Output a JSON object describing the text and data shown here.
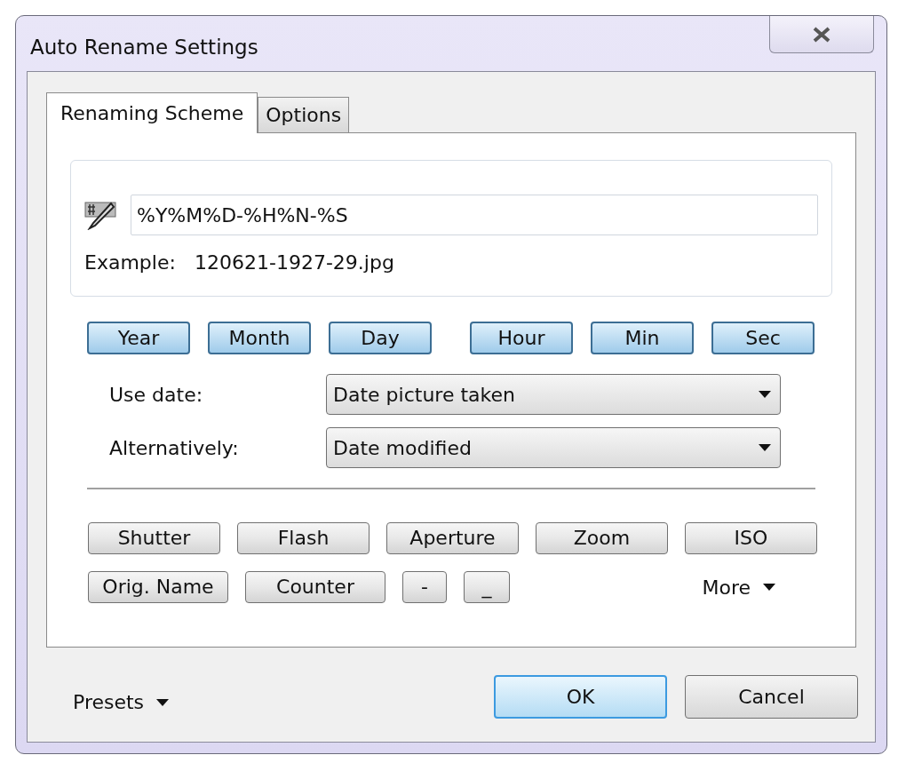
{
  "window": {
    "title": "Auto Rename Settings"
  },
  "tabs": [
    {
      "label": "Renaming Scheme",
      "selected": true
    },
    {
      "label": "Options",
      "selected": false
    }
  ],
  "scheme": {
    "value": "%Y%M%D-%H%N-%S",
    "example_label": "Example:",
    "example_value": "120621-1927-29.jpg"
  },
  "date_buttons": [
    "Year",
    "Month",
    "Day",
    "Hour",
    "Min",
    "Sec"
  ],
  "date_fields": [
    {
      "label": "Use date:",
      "value": "Date picture taken"
    },
    {
      "label": "Alternatively:",
      "value": "Date modified"
    }
  ],
  "field_buttons": [
    [
      "Shutter",
      "Flash",
      "Aperture",
      "Zoom",
      "ISO"
    ],
    [
      "Orig. Name",
      "Counter",
      "-",
      "_"
    ]
  ],
  "more": "More",
  "presets": "Presets",
  "buttons": [
    {
      "label": "OK",
      "default": true
    },
    {
      "label": "Cancel",
      "default": false
    }
  ]
}
